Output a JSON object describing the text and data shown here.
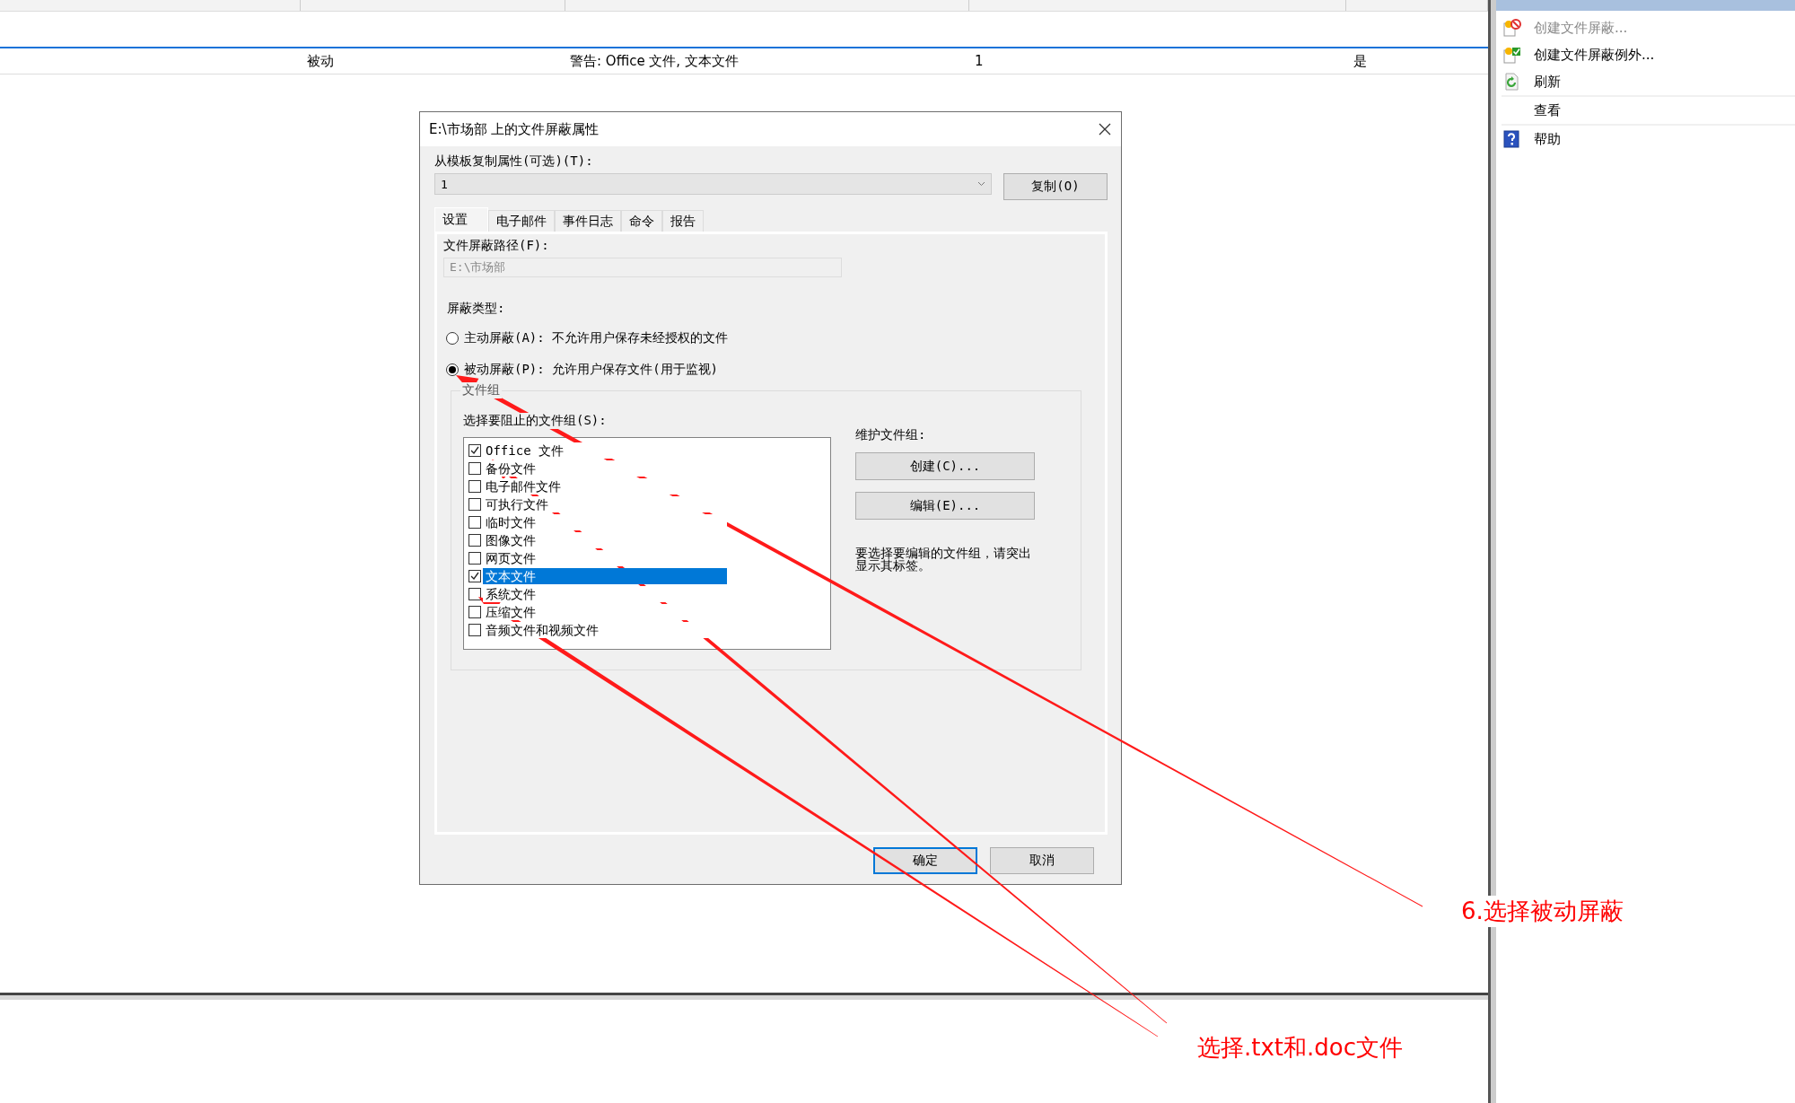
{
  "table": {
    "rows": [
      {
        "cells": [
          "被动",
          "警告: Office 文件, 文本文件",
          "1",
          "是"
        ]
      }
    ]
  },
  "actions_panel": {
    "items": [
      {
        "label": "创建文件屏蔽...",
        "kind": "screen",
        "disabled": true
      },
      {
        "label": "创建文件屏蔽例外...",
        "kind": "exception",
        "disabled": false
      },
      {
        "label": "刷新",
        "kind": "refresh",
        "disabled": false
      },
      {
        "label": "查看",
        "kind": "plain",
        "disabled": false
      },
      {
        "label": "帮助",
        "kind": "help",
        "disabled": false
      }
    ]
  },
  "dialog": {
    "title": "E:\\市场部 上的文件屏蔽属性",
    "template_label": "从模板复制属性(可选)(T):",
    "template_value": "1",
    "copy_button": "复制(O)",
    "tabs": [
      {
        "label": "设置",
        "selected": true
      },
      {
        "label": "电子邮件",
        "selected": false
      },
      {
        "label": "事件日志",
        "selected": false
      },
      {
        "label": "命令",
        "selected": false
      },
      {
        "label": "报告",
        "selected": false
      }
    ],
    "path_label": "文件屏蔽路径(F):",
    "path_value": "E:\\市场部",
    "screen_type_label": "屏蔽类型:",
    "screen_types": [
      {
        "label": "主动屏蔽(A): 不允许用户保存未经授权的文件",
        "selected": false
      },
      {
        "label": "被动屏蔽(P): 允许用户保存文件(用于监视)",
        "selected": true
      }
    ],
    "group_box_title": "文件组",
    "group_list_label": "选择要阻止的文件组(S):",
    "file_groups": [
      {
        "label": "Office 文件",
        "checked": true,
        "selected": false
      },
      {
        "label": "备份文件",
        "checked": false,
        "selected": false
      },
      {
        "label": "电子邮件文件",
        "checked": false,
        "selected": false
      },
      {
        "label": "可执行文件",
        "checked": false,
        "selected": false
      },
      {
        "label": "临时文件",
        "checked": false,
        "selected": false
      },
      {
        "label": "图像文件",
        "checked": false,
        "selected": false
      },
      {
        "label": "网页文件",
        "checked": false,
        "selected": false
      },
      {
        "label": "文本文件",
        "checked": true,
        "selected": true
      },
      {
        "label": "系统文件",
        "checked": false,
        "selected": false
      },
      {
        "label": "压缩文件",
        "checked": false,
        "selected": false
      },
      {
        "label": "音频文件和视频文件",
        "checked": false,
        "selected": false
      }
    ],
    "maintain_label": "维护文件组:",
    "create_button": "创建(C)...",
    "edit_button": "编辑(E)...",
    "hint": "要选择要编辑的文件组，请突出显示其标签。",
    "buttons": [
      {
        "label": "确定",
        "default": true
      },
      {
        "label": "取消",
        "default": false
      }
    ]
  },
  "annotations": [
    {
      "text": "6.选择被动屏蔽"
    },
    {
      "text": "选择.txt和.doc文件"
    }
  ]
}
